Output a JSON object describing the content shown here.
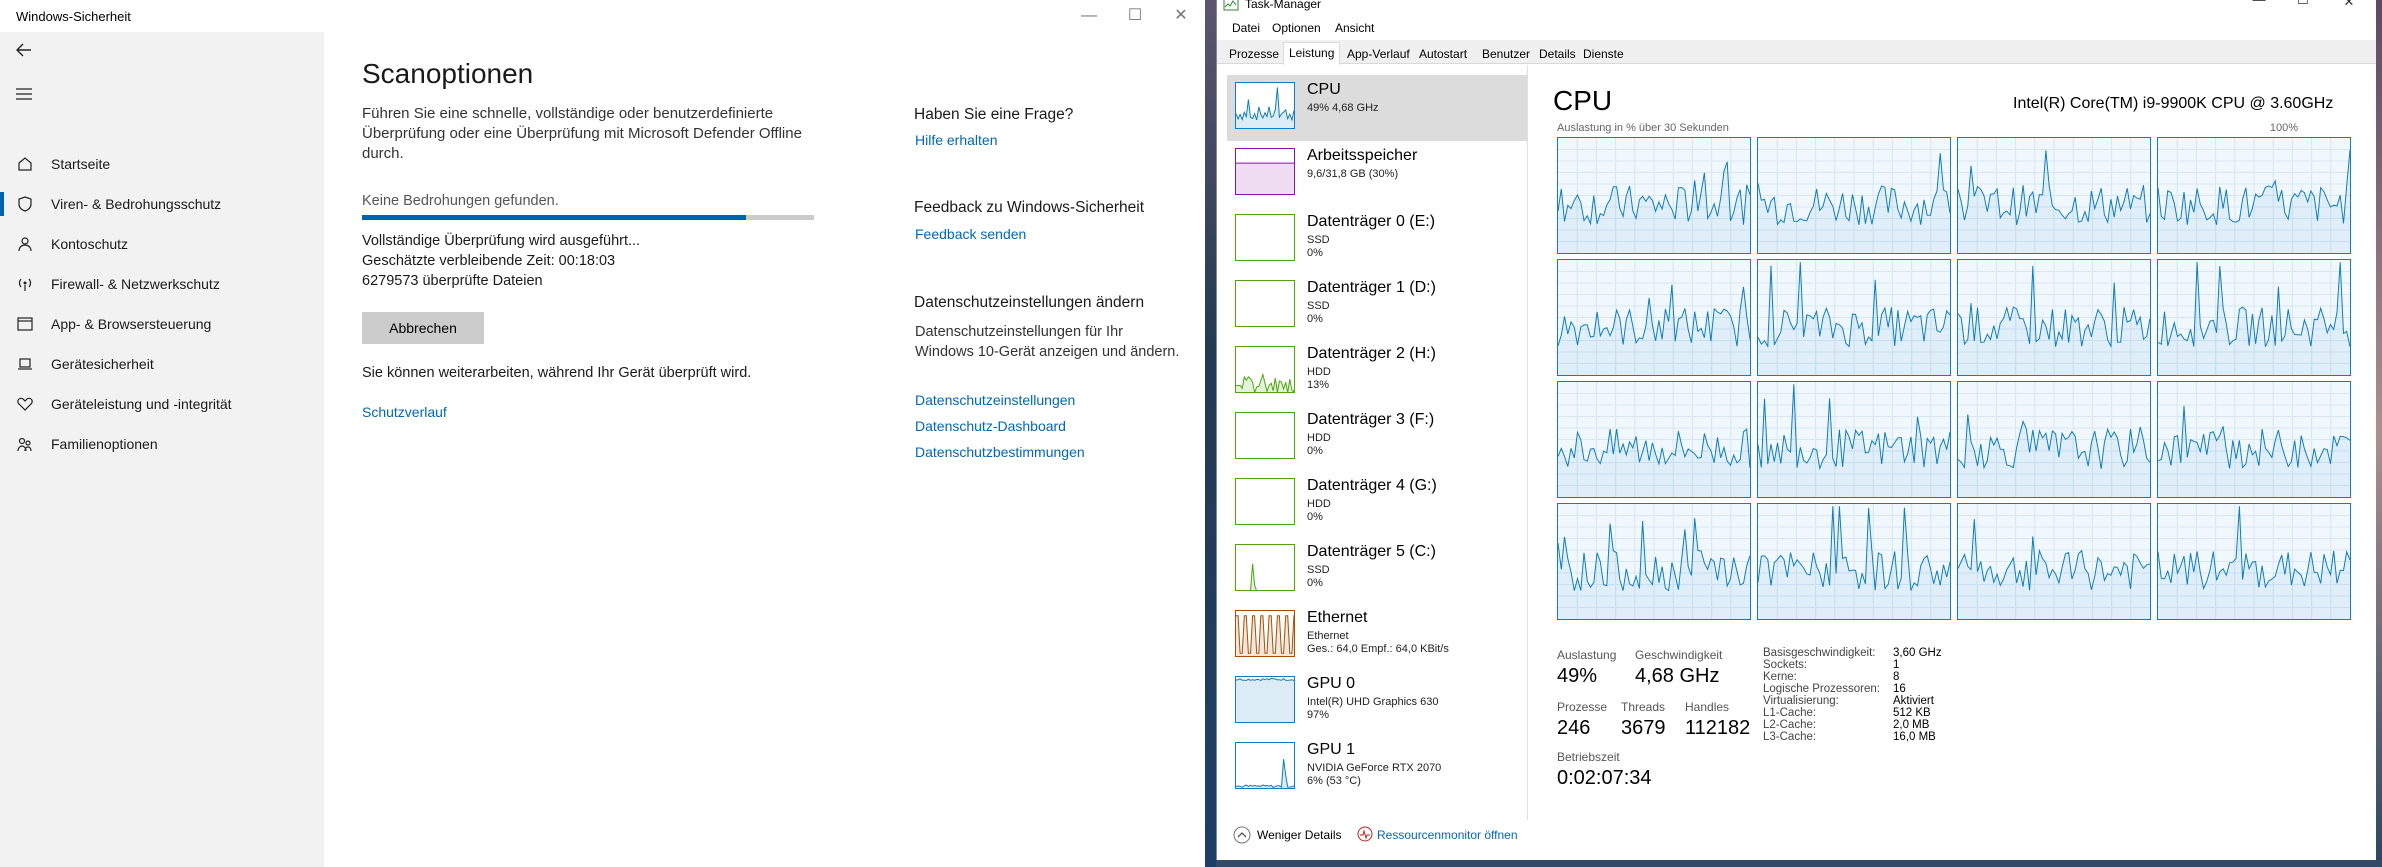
{
  "security": {
    "window_title": "Windows-Sicherheit",
    "nav": [
      {
        "label": "Startseite",
        "icon": "home-icon"
      },
      {
        "label": "Viren- & Bedrohungsschutz",
        "icon": "shield-icon"
      },
      {
        "label": "Kontoschutz",
        "icon": "person-icon"
      },
      {
        "label": "Firewall- & Netzwerkschutz",
        "icon": "wireless-icon"
      },
      {
        "label": "App- & Browsersteuerung",
        "icon": "app-window-icon"
      },
      {
        "label": "Gerätesicherheit",
        "icon": "laptop-icon"
      },
      {
        "label": "Geräteleistung und -integrität",
        "icon": "heart-icon"
      },
      {
        "label": "Familienoptionen",
        "icon": "family-icon"
      }
    ],
    "selected_nav_index": 1,
    "page_title": "Scanoptionen",
    "intro": "Führen Sie eine schnelle, vollständige oder benutzerdefinierte Überprüfung oder eine Überprüfung mit Microsoft Defender Offline durch.",
    "status": "Keine Bedrohungen gefunden.",
    "progress": 0.85,
    "scan_running": "Vollständige Überprüfung wird ausgeführt...",
    "remaining": "Geschätzte verbleibende Zeit: 00:18:03",
    "files_checked": "6279573 überprüfte Dateien",
    "cancel_label": "Abbrechen",
    "continue_note": "Sie können weiterarbeiten, während Ihr Gerät überprüft wird.",
    "history_link": "Schutzverlauf",
    "question_heading": "Haben Sie eine Frage?",
    "help_link": "Hilfe erhalten",
    "feedback_heading": "Feedback zu Windows-Sicherheit",
    "feedback_link": "Feedback senden",
    "privacy_heading": "Datenschutzeinstellungen ändern",
    "privacy_text": "Datenschutzeinstellungen für Ihr Windows 10-Gerät anzeigen und ändern.",
    "privacy_links": [
      "Datenschutzeinstellungen",
      "Datenschutz-Dashboard",
      "Datenschutzbestimmungen"
    ]
  },
  "taskmanager": {
    "window_title": "Task-Manager",
    "menu": [
      "Datei",
      "Optionen",
      "Ansicht"
    ],
    "tabs": [
      "Prozesse",
      "Leistung",
      "App-Verlauf",
      "Autostart",
      "Benutzer",
      "Details",
      "Dienste"
    ],
    "active_tab_index": 1,
    "resources": [
      {
        "name": "CPU",
        "l2": "49% 4,68 GHz",
        "l3": "",
        "color": "#117dbb",
        "kind": "cpu"
      },
      {
        "name": "Arbeitsspeicher",
        "l2": "9,6/31,8 GB (30%)",
        "l3": "",
        "color": "#8b12ae",
        "kind": "mem"
      },
      {
        "name": "Datenträger 0 (E:)",
        "l2": "SSD",
        "l3": "0%",
        "color": "#4da60c",
        "kind": "flat"
      },
      {
        "name": "Datenträger 1 (D:)",
        "l2": "SSD",
        "l3": "0%",
        "color": "#4da60c",
        "kind": "flat"
      },
      {
        "name": "Datenträger 2 (H:)",
        "l2": "HDD",
        "l3": "13%",
        "color": "#4da60c",
        "kind": "disk"
      },
      {
        "name": "Datenträger 3 (F:)",
        "l2": "HDD",
        "l3": "0%",
        "color": "#4da60c",
        "kind": "flat"
      },
      {
        "name": "Datenträger 4 (G:)",
        "l2": "HDD",
        "l3": "0%",
        "color": "#4da60c",
        "kind": "flat"
      },
      {
        "name": "Datenträger 5 (C:)",
        "l2": "SSD",
        "l3": "0%",
        "color": "#4da60c",
        "kind": "spike"
      },
      {
        "name": "Ethernet",
        "l2": "Ethernet",
        "l3": "Ges.: 64,0  Empf.: 64,0 KBit/s",
        "color": "#a74f01",
        "kind": "eth"
      },
      {
        "name": "GPU 0",
        "l2": "Intel(R) UHD Graphics 630",
        "l3": "97%",
        "color": "#117dbb",
        "kind": "gpu0"
      },
      {
        "name": "GPU 1",
        "l2": "NVIDIA GeForce RTX 2070",
        "l3": "6% (53 °C)",
        "color": "#117dbb",
        "kind": "gpu1"
      }
    ],
    "selected_resource_index": 0,
    "cpu_title": "CPU",
    "cpu_model": "Intel(R) Core(TM) i9-9900K CPU @ 3.60GHz",
    "graph_caption": "Auslastung in % über 30 Sekunden",
    "graph_max": "100%",
    "core_count": 16,
    "stats": {
      "util_label": "Auslastung",
      "util_value": "49%",
      "speed_label": "Geschwindigkeit",
      "speed_value": "4,68 GHz",
      "proc_label": "Prozesse",
      "proc_value": "246",
      "threads_label": "Threads",
      "threads_value": "3679",
      "handles_label": "Handles",
      "handles_value": "112182",
      "uptime_label": "Betriebszeit",
      "uptime_value": "0:02:07:34"
    },
    "specs": [
      {
        "k": "Basisgeschwindigkeit:",
        "v": "3,60 GHz"
      },
      {
        "k": "Sockets:",
        "v": "1"
      },
      {
        "k": "Kerne:",
        "v": "8"
      },
      {
        "k": "Logische Prozessoren:",
        "v": "16"
      },
      {
        "k": "Virtualisierung:",
        "v": "Aktiviert"
      },
      {
        "k": "L1-Cache:",
        "v": "512 KB"
      },
      {
        "k": "L2-Cache:",
        "v": "2,0 MB"
      },
      {
        "k": "L3-Cache:",
        "v": "16,0 MB"
      }
    ],
    "footer_less": "Weniger Details",
    "footer_monitor": "Ressourcenmonitor öffnen"
  }
}
